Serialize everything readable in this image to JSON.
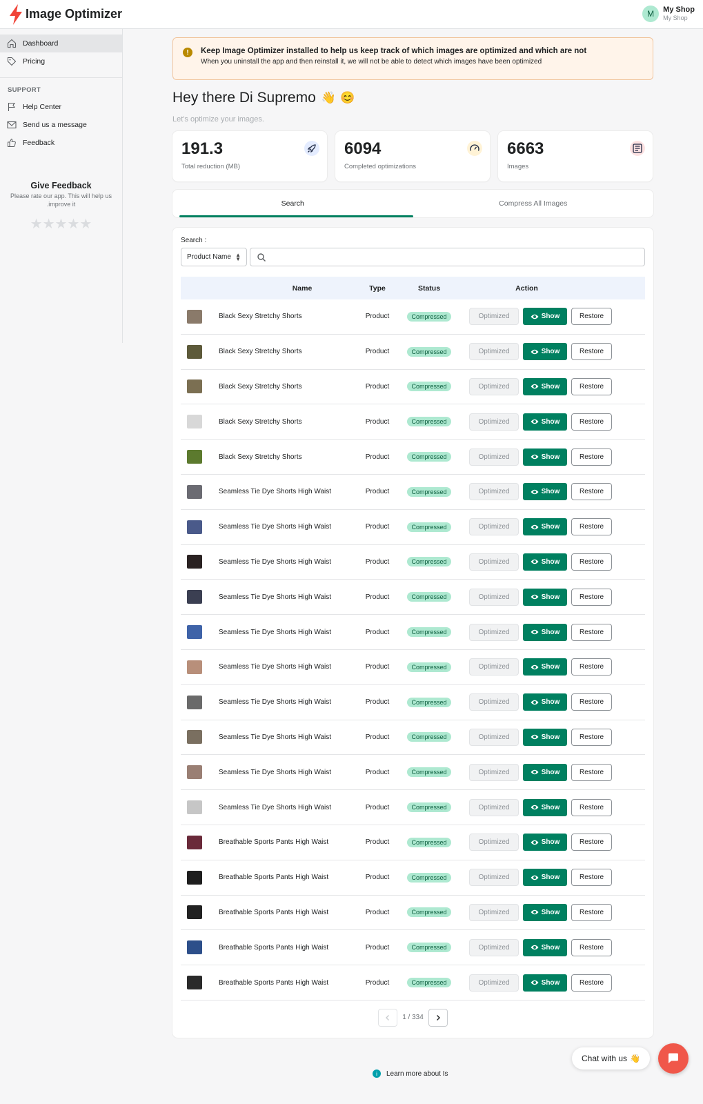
{
  "app": {
    "title": "Image Optimizer",
    "brand_color": "#f04438",
    "accent": "#008060"
  },
  "shop": {
    "avatar": "M",
    "name": "My Shop",
    "sub": "My Shop"
  },
  "sidebar": {
    "items": [
      {
        "label": "Dashboard",
        "icon": "home-icon"
      },
      {
        "label": "Pricing",
        "icon": "tag-icon"
      }
    ],
    "support_heading": "SUPPORT",
    "support_items": [
      {
        "label": "Help Center",
        "icon": "flag-icon"
      },
      {
        "label": "Send us a message",
        "icon": "mail-icon"
      },
      {
        "label": "Feedback",
        "icon": "thumbs-up-icon"
      }
    ],
    "feedback": {
      "title": "Give Feedback",
      "text": "Please rate our app. This will help us .improve it",
      "rating": 0,
      "max_rating": 5
    }
  },
  "banner": {
    "title": "Keep Image Optimizer installed to help us keep track of which images are optimized and which are not",
    "text": "When you uninstall the app and then reinstall it, we will not be able to detect which images have been optimized"
  },
  "greeting": {
    "title": "Hey there Di Supremo",
    "emoji_wave": "👋",
    "emoji_smile": "😊",
    "subtitle": "Let's optimize your images."
  },
  "stats": [
    {
      "value": "191.3",
      "label": "Total reduction (MB)",
      "icon": "rocket-icon"
    },
    {
      "value": "6094",
      "label": "Completed optimizations",
      "icon": "speedometer-icon"
    },
    {
      "value": "6663",
      "label": "Images",
      "icon": "image-icon"
    }
  ],
  "tabs": [
    {
      "label": "Search",
      "active": true
    },
    {
      "label": "Compress All Images",
      "active": false
    }
  ],
  "search": {
    "label": "Search :",
    "select_value": "Product Name",
    "placeholder": ""
  },
  "table": {
    "headers": {
      "name": "Name",
      "type": "Type",
      "status": "Status",
      "action": "Action"
    },
    "buttons": {
      "optimized": "Optimized",
      "show": "Show",
      "restore": "Restore"
    },
    "rows": [
      {
        "name": "Black Sexy Stretchy Shorts",
        "type": "Product",
        "status": "Compressed",
        "thumb": "#8a7a6a"
      },
      {
        "name": "Black Sexy Stretchy Shorts",
        "type": "Product",
        "status": "Compressed",
        "thumb": "#5d5a3a"
      },
      {
        "name": "Black Sexy Stretchy Shorts",
        "type": "Product",
        "status": "Compressed",
        "thumb": "#7b6f52"
      },
      {
        "name": "Black Sexy Stretchy Shorts",
        "type": "Product",
        "status": "Compressed",
        "thumb": "#d8d8d8"
      },
      {
        "name": "Black Sexy Stretchy Shorts",
        "type": "Product",
        "status": "Compressed",
        "thumb": "#5c7a2e"
      },
      {
        "name": "Seamless Tie Dye Shorts High Waist",
        "type": "Product",
        "status": "Compressed",
        "thumb": "#6b6b72"
      },
      {
        "name": "Seamless Tie Dye Shorts High Waist",
        "type": "Product",
        "status": "Compressed",
        "thumb": "#4a5a8a"
      },
      {
        "name": "Seamless Tie Dye Shorts High Waist",
        "type": "Product",
        "status": "Compressed",
        "thumb": "#2a2222"
      },
      {
        "name": "Seamless Tie Dye Shorts High Waist",
        "type": "Product",
        "status": "Compressed",
        "thumb": "#3b3f52"
      },
      {
        "name": "Seamless Tie Dye Shorts High Waist",
        "type": "Product",
        "status": "Compressed",
        "thumb": "#3f63a8"
      },
      {
        "name": "Seamless Tie Dye Shorts High Waist",
        "type": "Product",
        "status": "Compressed",
        "thumb": "#b88f7a"
      },
      {
        "name": "Seamless Tie Dye Shorts High Waist",
        "type": "Product",
        "status": "Compressed",
        "thumb": "#6a6a6a"
      },
      {
        "name": "Seamless Tie Dye Shorts High Waist",
        "type": "Product",
        "status": "Compressed",
        "thumb": "#7a6f60"
      },
      {
        "name": "Seamless Tie Dye Shorts High Waist",
        "type": "Product",
        "status": "Compressed",
        "thumb": "#9a7f74"
      },
      {
        "name": "Seamless Tie Dye Shorts High Waist",
        "type": "Product",
        "status": "Compressed",
        "thumb": "#c6c6c6"
      },
      {
        "name": "Breathable Sports Pants High Waist",
        "type": "Product",
        "status": "Compressed",
        "thumb": "#6a2a3a"
      },
      {
        "name": "Breathable Sports Pants High Waist",
        "type": "Product",
        "status": "Compressed",
        "thumb": "#1e1e1e"
      },
      {
        "name": "Breathable Sports Pants High Waist",
        "type": "Product",
        "status": "Compressed",
        "thumb": "#222222"
      },
      {
        "name": "Breathable Sports Pants High Waist",
        "type": "Product",
        "status": "Compressed",
        "thumb": "#2d4f8a"
      },
      {
        "name": "Breathable Sports Pants High Waist",
        "type": "Product",
        "status": "Compressed",
        "thumb": "#2a2a2a"
      }
    ]
  },
  "pagination": {
    "text": "1 / 334",
    "current": 1,
    "total": 334
  },
  "footer": {
    "learn_more": "Learn more about Is"
  },
  "chat": {
    "label": "Chat with us",
    "emoji": "👋"
  }
}
